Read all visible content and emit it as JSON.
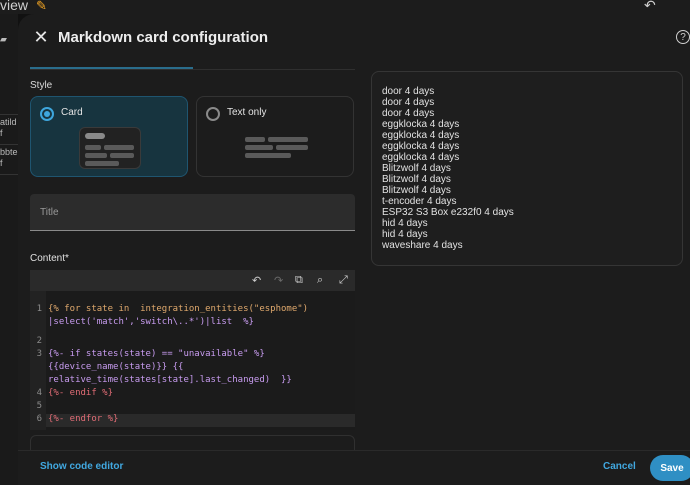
{
  "background": {
    "title_fragment": "view",
    "left_items": [
      {
        "line1": "atild",
        "line2": "f"
      },
      {
        "line1": "bbte",
        "line2": "f"
      }
    ]
  },
  "dialog": {
    "title": "Markdown card configuration",
    "help_icon": "?"
  },
  "editor": {
    "style_label": "Style",
    "style_options": [
      {
        "label": "Card",
        "selected": true
      },
      {
        "label": "Text only",
        "selected": false
      }
    ],
    "title_field": {
      "placeholder": "Title",
      "value": ""
    },
    "content_label": "Content*",
    "code": {
      "line_numbers": [
        "1",
        "",
        "2",
        "3",
        "",
        "",
        "4",
        "5",
        "6"
      ],
      "lines": [
        "{% for state in  integration_entities(\"esphome\")",
        "|select('match','switch\\..*')|list  %}",
        "",
        "{%- if states(state) == \"unavailable\" %}",
        "{{device_name(state)}} {{",
        "relative_time(states[state].last_changed)  }}",
        "{%- endif %}",
        "{%- endfor %}"
      ]
    }
  },
  "preview": {
    "lines": [
      "door 4 days",
      "door 4 days",
      "door 4 days",
      "eggklocka 4 days",
      "eggklocka 4 days",
      "eggklocka 4 days",
      "eggklocka 4 days",
      "Blitzwolf 4 days",
      "Blitzwolf 4 days",
      "Blitzwolf 4 days",
      "t-encoder 4 days",
      "ESP32 S3 Box e232f0 4 days",
      "hid 4 days",
      "hid 4 days",
      "waveshare 4 days"
    ]
  },
  "footer": {
    "show_code_label": "Show code editor",
    "cancel_label": "Cancel",
    "save_label": "Save"
  },
  "colors": {
    "accent": "#41a8e0",
    "save_button": "#2f8fc4",
    "selected_option_bg": "#17343f"
  }
}
